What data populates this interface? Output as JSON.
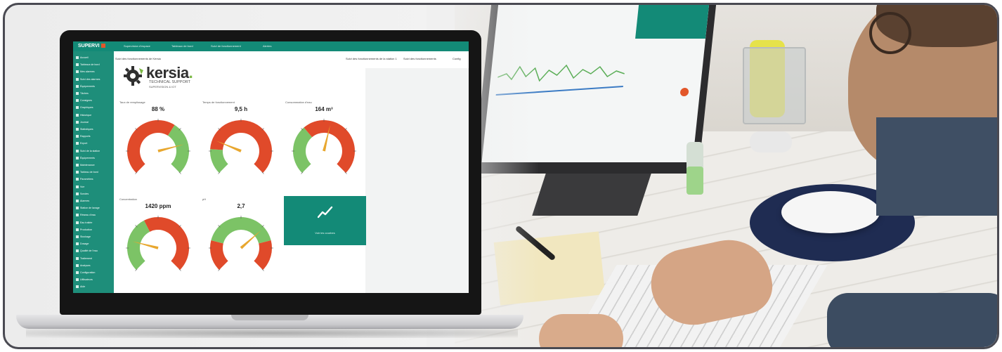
{
  "app": {
    "brand": "SUPERVI",
    "top_menu": [
      "Supervision d'espace",
      "Tableaux de bord",
      "Suivi de fonctionnement",
      "Alertes"
    ],
    "sub_left": "Suivi des fonctionnements de Kersia",
    "sub_right": [
      "Suivi des fonctionnements de la station 1",
      "Suivi des fonctionnements",
      "Config"
    ]
  },
  "sidebar": {
    "items": [
      "Accueil",
      "Tableaux de bord",
      "Mes alarmes",
      "Suivi des alarmes",
      "Équipements",
      "Tâches",
      "Consignes",
      "Graphiques",
      "Historique",
      "Journal",
      "Statistiques",
      "Rapports",
      "Export",
      "Suivi de la station",
      "Équipements",
      "Maintenance",
      "Tableau de bord",
      "Paramètres",
      "Vue",
      "Sondes",
      "Alarmes",
      "Station de lavage",
      "Réseau d'eau",
      "Eau traitée",
      "Production",
      "Stockage",
      "Dosage",
      "Qualité de l'eau",
      "Traitement",
      "Analyses",
      "Configuration",
      "Utilisateurs",
      "Aide"
    ]
  },
  "logo": {
    "name": "kersia",
    "line1": "TECHNICAL SUPPORT",
    "line2": "SUPERVISION & IOT"
  },
  "gauges": [
    {
      "label": "Taux de remplissage",
      "value_text": "88 %",
      "needle": 0.78,
      "green_from": 0.62
    },
    {
      "label": "Temps de fonctionnement",
      "value_text": "9,5 h",
      "needle": 0.25,
      "green_from": -1,
      "green_to": 0.18
    },
    {
      "label": "Consommation d'eau",
      "value_text": "164 m³",
      "needle": 0.55,
      "green_from": -1,
      "green_to": 0.35
    },
    {
      "label": "Concentration",
      "value_text": "1420 ppm",
      "needle": 0.22,
      "green_from": -1,
      "green_to": 0.4
    },
    {
      "label": "pH",
      "value_text": "2,7",
      "needle": 0.68,
      "green_from": 0.22,
      "green_to": 0.78
    }
  ],
  "tile": {
    "icon": "trend-chart-icon",
    "label": "Voir les courbes"
  },
  "colors": {
    "teal": "#138a77",
    "gauge_red": "#e04a2a",
    "gauge_green": "#7cc366",
    "needle": "#e8a72f",
    "orange_dot": "#e2572a"
  }
}
